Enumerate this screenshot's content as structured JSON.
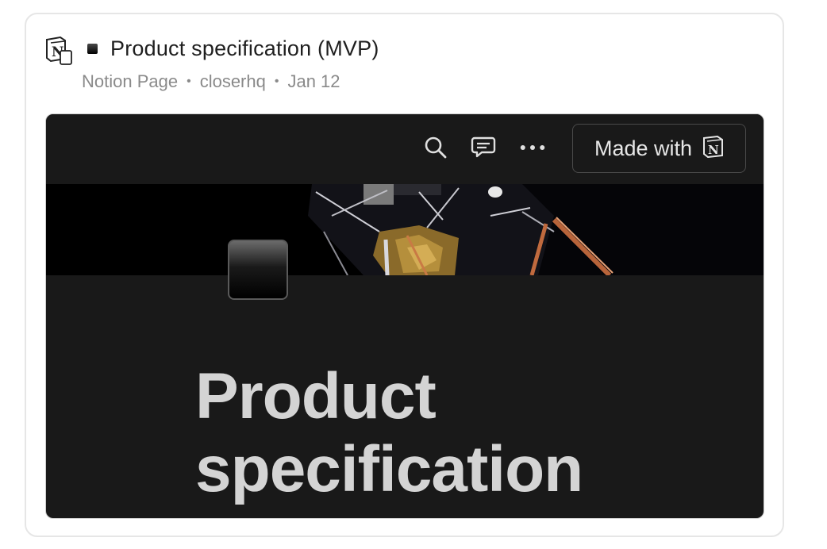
{
  "card": {
    "title_emoji": "black-small-square",
    "title": "Product specification (MVP)",
    "meta": {
      "source": "Notion Page",
      "author": "closerhq",
      "date": "Jan 12",
      "separator": "•"
    }
  },
  "preview": {
    "toolbar": {
      "search_icon": "search-icon",
      "comment_icon": "comment-icon",
      "more_icon": "more-icon",
      "made_with_label": "Made with"
    },
    "cover_image": "lunar-module-photo",
    "page_title_line1": "Product",
    "page_title_line2": "specification"
  },
  "colors": {
    "preview_bg": "#191919",
    "title_text": "#1f1f1f",
    "meta_text": "#8a8a8a",
    "page_title": "#d4d4d4"
  }
}
